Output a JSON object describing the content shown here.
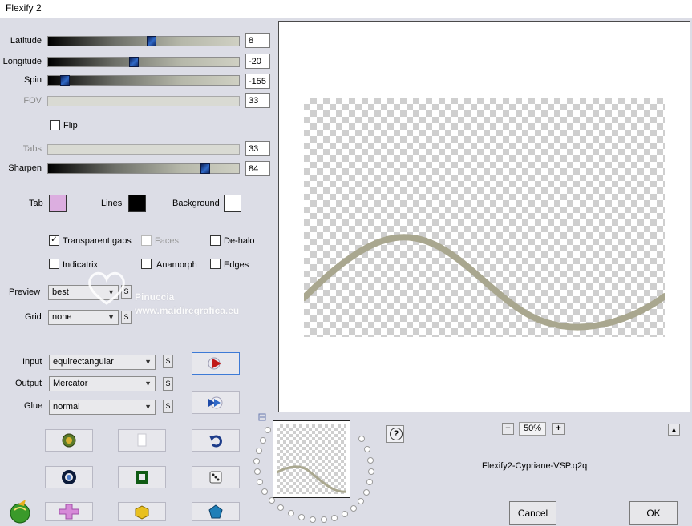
{
  "window": {
    "title": "Flexify 2"
  },
  "sliders": [
    {
      "label": "Latitude",
      "value": "8",
      "fraction": 0.54,
      "enabled": true
    },
    {
      "label": "Longitude",
      "value": "-20",
      "fraction": 0.44,
      "enabled": true
    },
    {
      "label": "Spin",
      "value": "-155",
      "fraction": 0.07,
      "enabled": true
    },
    {
      "label": "FOV",
      "value": "33",
      "fraction": null,
      "enabled": false
    },
    {
      "label": "Tabs",
      "value": "33",
      "fraction": null,
      "enabled": false
    },
    {
      "label": "Sharpen",
      "value": "84",
      "fraction": 0.82,
      "enabled": true
    }
  ],
  "flip": {
    "label": "Flip",
    "checked": false
  },
  "colors": {
    "tab": {
      "label": "Tab",
      "color": "#dcaee0"
    },
    "lines": {
      "label": "Lines",
      "color": "#000000"
    },
    "background": {
      "label": "Background",
      "color": "#ffffff"
    }
  },
  "options": {
    "transparent_gaps": {
      "label": "Transparent gaps",
      "checked": true
    },
    "faces": {
      "label": "Faces",
      "checked": false,
      "enabled": false
    },
    "de_halo": {
      "label": "De-halo",
      "checked": false
    },
    "indicatrix": {
      "label": "Indicatrix",
      "checked": false
    },
    "anamorph": {
      "label": "Anamorph",
      "checked": false
    },
    "edges": {
      "label": "Edges",
      "checked": false
    }
  },
  "dropdowns": {
    "preview": {
      "label": "Preview",
      "value": "best"
    },
    "grid": {
      "label": "Grid",
      "value": "none"
    },
    "input": {
      "label": "Input",
      "value": "equirectangular"
    },
    "output": {
      "label": "Output",
      "value": "Mercator"
    },
    "glue": {
      "label": "Glue",
      "value": "normal"
    }
  },
  "small_button_label": "S",
  "watermark": {
    "line1": "Pinuccia",
    "line2": "www.maidiregrafica.eu"
  },
  "zoom": {
    "minus": "−",
    "value": "50%",
    "plus": "+"
  },
  "preset_name": "Flexify2-Cypriane-VSP.q2q",
  "help_label": "?",
  "collapse_label": "▲",
  "buttons": {
    "cancel": "Cancel",
    "ok": "OK"
  },
  "accent_colors": {
    "curve": "#a9a78f",
    "slider_thumb": "#2f69c8"
  }
}
